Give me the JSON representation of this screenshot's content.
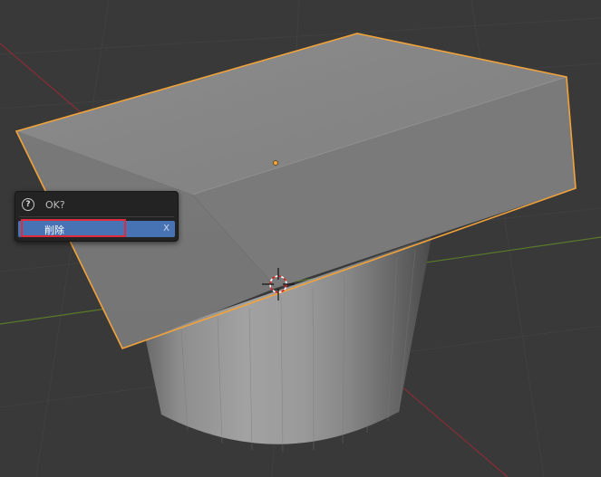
{
  "viewport": {
    "background": "#393939",
    "object_outline_color": "#f2a33a",
    "x_axis_color": "#8a2d36",
    "y_axis_color": "#5a7a2a"
  },
  "dialog": {
    "icon": "question-icon",
    "icon_glyph": "?",
    "title": "OK?",
    "item_label": "削除",
    "item_shortcut": "X",
    "item_bg_color": "#4772b3",
    "highlight_color": "#e02b3c"
  },
  "scene_objects": {
    "origin_marker": "object-origin-dot",
    "cursor": "3d-cursor-icon"
  }
}
